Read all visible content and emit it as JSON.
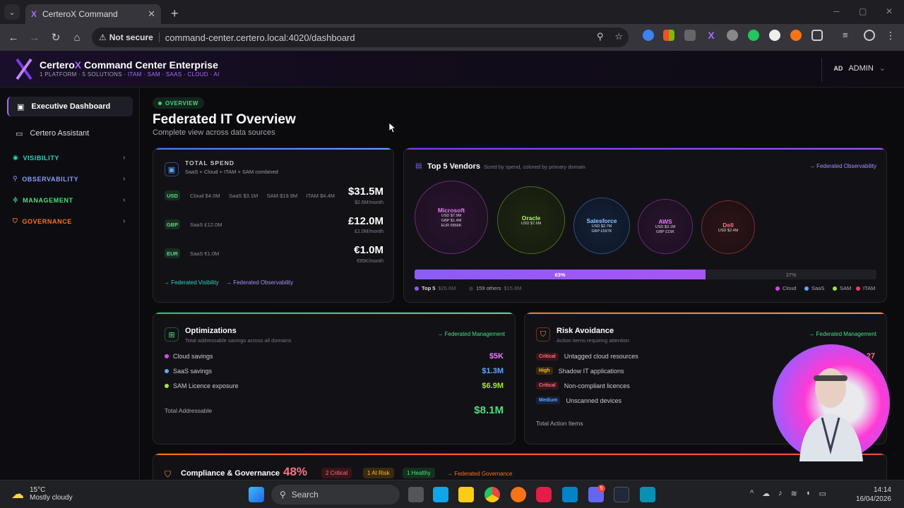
{
  "browser": {
    "tab_title": "CerteroX Command",
    "not_secure": "Not secure",
    "url": "command-center.certero.local:4020/dashboard"
  },
  "app": {
    "brand_a": "Certero",
    "brand_x": "X",
    "brand_b": " Command Center Enterprise",
    "tag_a": "1 PLATFORM · 5 SOLUTIONS · ",
    "tag_b": "ITAM · SAM · SAAS · CLOUD · AI",
    "user_initials": "AD",
    "user_name": "ADMIN"
  },
  "sidebar": {
    "items": [
      {
        "label": "Executive Dashboard"
      },
      {
        "label": "Certero Assistant"
      }
    ],
    "groups": [
      {
        "label": "VISIBILITY",
        "color": "#2dd4bf"
      },
      {
        "label": "OBSERVABILITY",
        "color": "#8b9cff"
      },
      {
        "label": "MANAGEMENT",
        "color": "#4ade80"
      },
      {
        "label": "GOVERNANCE",
        "color": "#f97316"
      }
    ]
  },
  "page": {
    "pill": "OVERVIEW",
    "title": "Federated IT Overview",
    "subtitle": "Complete view across data sources"
  },
  "spend": {
    "title": "TOTAL SPEND",
    "subtitle": "SaaS + Cloud + ITAM + SAM combined",
    "rows": [
      {
        "cur": "USD",
        "detail": "Cloud $4.0M      SaaS $3.1M      SAM $19.9M      ITAM $4.4M",
        "amount": "$31.5M",
        "per": "$2.6M/month"
      },
      {
        "cur": "GBP",
        "detail": "SaaS £12.0M",
        "amount": "£12.0M",
        "per": "£1.0M/month"
      },
      {
        "cur": "EUR",
        "detail": "SaaS €1.0M",
        "amount": "€1.0M",
        "per": "€85K/month"
      }
    ],
    "link1": "→ Federated Visibility",
    "link2": "→ Federated Observability"
  },
  "vendors": {
    "title": "Top 5 Vendors",
    "subtitle": "Sized by spend, colored by primary domain",
    "link": "→ Federated Observability",
    "items": [
      {
        "name": "Microsoft",
        "l1": "USD $7.9M",
        "l2": "GBP $1.4M",
        "l3": "EUR €866K",
        "color": "#d946ef"
      },
      {
        "name": "Oracle",
        "l1": "USD $7.6M",
        "l2": "",
        "l3": "",
        "color": "#a3e635"
      },
      {
        "name": "Salesforce",
        "l1": "USD $2.7M",
        "l2": "GBP £597K",
        "l3": "",
        "color": "#60a5fa"
      },
      {
        "name": "AWS",
        "l1": "USD $3.1M",
        "l2": "GBP £15K",
        "l3": "",
        "color": "#d946ef"
      },
      {
        "name": "Dell",
        "l1": "USD $2.4M",
        "l2": "",
        "l3": "",
        "color": "#f43f5e"
      }
    ],
    "bar_top_pct": "63%",
    "bar_rest_pct": "37%",
    "bar_fraction": 0.63,
    "top5_label": "Top 5",
    "top5_value": "$26.6M",
    "others_label": "159 others",
    "others_value": "$15.8M",
    "legend": [
      {
        "label": "Cloud",
        "color": "#d946ef"
      },
      {
        "label": "SaaS",
        "color": "#60a5fa"
      },
      {
        "label": "SAM",
        "color": "#a3e635"
      },
      {
        "label": "ITAM",
        "color": "#f43f5e"
      }
    ]
  },
  "optimizations": {
    "title": "Optimizations",
    "subtitle": "Total addressable savings across all domains",
    "link": "→ Federated Management",
    "rows": [
      {
        "label": "Cloud savings",
        "value": "$5K",
        "color": "#d946ef"
      },
      {
        "label": "SaaS savings",
        "value": "$1.3M",
        "color": "#60a5fa"
      },
      {
        "label": "SAM Licence exposure",
        "value": "$6.9M",
        "color": "#a3e635"
      }
    ],
    "total_label": "Total Addressable",
    "total_value": "$8.1M"
  },
  "risk": {
    "title": "Risk Avoidance",
    "subtitle": "Action items requiring attention",
    "link": "→ Federated Management",
    "rows": [
      {
        "sev": "Critical",
        "label": "Untagged cloud resources"
      },
      {
        "sev": "High",
        "label": "Shadow IT applications"
      },
      {
        "sev": "Critical",
        "label": "Non-compliant licences"
      },
      {
        "sev": "Medium",
        "label": "Unscanned devices"
      }
    ],
    "partial_value": "27",
    "total_label": "Total Action Items"
  },
  "compliance": {
    "title": "Compliance & Governance",
    "pct": "48%",
    "b1": "2 Critical",
    "b2": "1 At Risk",
    "b3": "1 Healthy",
    "link": "→ Federated Governance"
  },
  "taskbar": {
    "temp": "15°C",
    "weather": "Mostly cloudy",
    "search": "Search",
    "time": "14:14",
    "date": "16/04/2026",
    "badge": "5"
  }
}
